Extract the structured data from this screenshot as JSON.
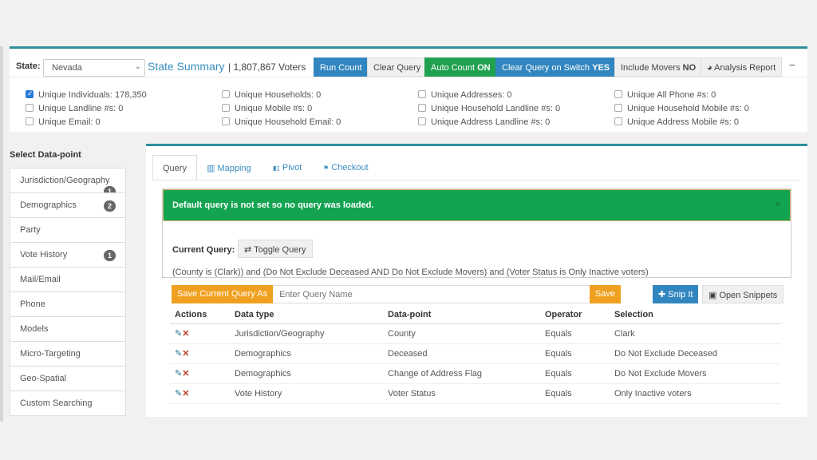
{
  "header": {
    "state_label": "State:",
    "state_value": "Nevada",
    "summary_link": "State Summary",
    "voters": "| 1,807,867 Voters",
    "buttons": {
      "run_count": "Run Count",
      "clear_query": "Clear Query",
      "auto_count": "Auto Count",
      "auto_count_state": "ON",
      "clear_on_switch": "Clear Query on Switch",
      "clear_on_switch_state": "YES",
      "include_movers": "Include Movers",
      "include_movers_state": "NO",
      "analysis_report": "Analysis Report"
    }
  },
  "counts": [
    {
      "label": "Unique Individuals: 178,350",
      "checked": true
    },
    {
      "label": "Unique Households: 0",
      "checked": false
    },
    {
      "label": "Unique Addresses: 0",
      "checked": false
    },
    {
      "label": "Unique All Phone #s: 0",
      "checked": false
    },
    {
      "label": "Unique Landline #s: 0",
      "checked": false
    },
    {
      "label": "Unique Mobile #s: 0",
      "checked": false
    },
    {
      "label": "Unique Household Landline #s: 0",
      "checked": false
    },
    {
      "label": "Unique Household Mobile #s: 0",
      "checked": false
    },
    {
      "label": "Unique Email: 0",
      "checked": false
    },
    {
      "label": "Unique Household Email: 0",
      "checked": false
    },
    {
      "label": "Unique Address Landline #s: 0",
      "checked": false
    },
    {
      "label": "Unique Address Mobile #s: 0",
      "checked": false
    }
  ],
  "sidebar": {
    "title": "Select Data-point",
    "items": [
      {
        "label": "Jurisdiction/Geography",
        "badge": "1"
      },
      {
        "label": "Demographics",
        "badge": "2"
      },
      {
        "label": "Party"
      },
      {
        "label": "Vote History",
        "badge": "1"
      },
      {
        "label": "Mail/Email"
      },
      {
        "label": "Phone"
      },
      {
        "label": "Models"
      },
      {
        "label": "Micro-Targeting"
      },
      {
        "label": "Geo-Spatial"
      },
      {
        "label": "Custom Searching"
      }
    ]
  },
  "tabs": [
    {
      "label": "Query",
      "icon": ""
    },
    {
      "label": "Mapping",
      "icon": "map-icon"
    },
    {
      "label": "Pivot",
      "icon": "bar-chart-icon"
    },
    {
      "label": "Checkout",
      "icon": "flag-icon"
    }
  ],
  "alert": {
    "message": "Default query is not set so no query was loaded.",
    "close": "×"
  },
  "query": {
    "label": "Current Query:",
    "toggle": "Toggle Query",
    "text": "(County is (Clark)) and (Do Not Exclude Deceased AND Do Not Exclude Movers) and (Voter Status is Only Inactive voters)"
  },
  "save": {
    "save_as": "Save Current Query As",
    "placeholder": "Enter Query Name",
    "save": "Save",
    "snip": "Snip It",
    "open_snippets": "Open Snippets"
  },
  "table": {
    "headers": [
      "Actions",
      "Data type",
      "Data-point",
      "Operator",
      "Selection"
    ],
    "rows": [
      [
        "Jurisdiction/Geography",
        "County",
        "Equals",
        "Clark"
      ],
      [
        "Demographics",
        "Deceased",
        "Equals",
        "Do Not Exclude Deceased"
      ],
      [
        "Demographics",
        "Change of Address Flag",
        "Equals",
        "Do Not Exclude Movers"
      ],
      [
        "Vote History",
        "Voter Status",
        "Equals",
        "Only Inactive voters"
      ]
    ]
  },
  "colors": {
    "accent": "#2f8f9d",
    "primary": "#3286c0",
    "success": "#1fa14f",
    "warning": "#f0a020"
  }
}
